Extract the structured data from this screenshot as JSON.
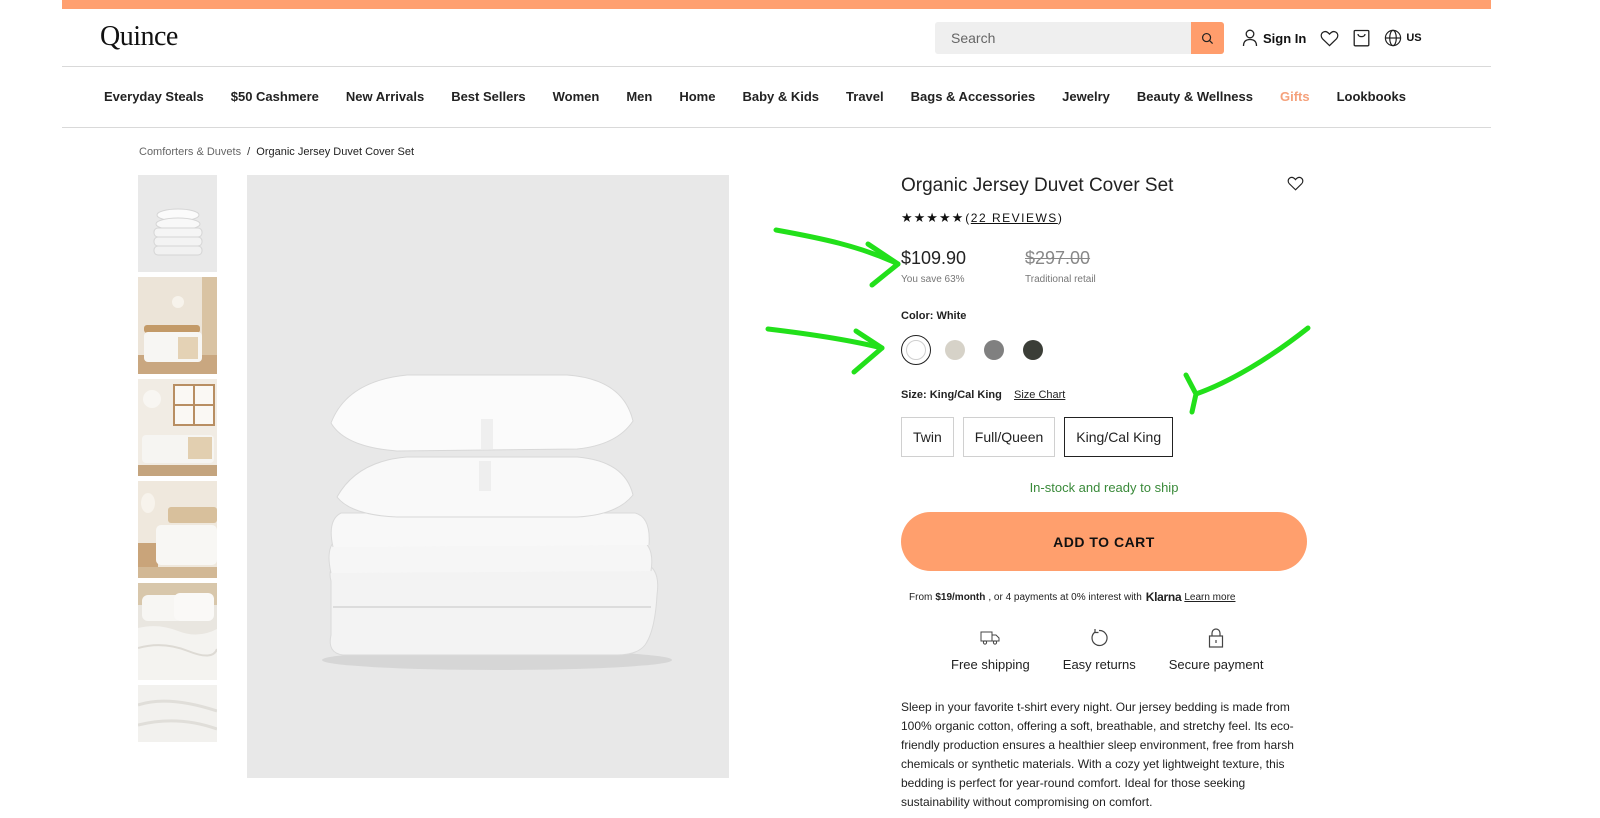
{
  "header": {
    "logo": "Quince",
    "search_placeholder": "Search",
    "sign_in": "Sign In",
    "locale": "US"
  },
  "nav": {
    "items": [
      {
        "label": "Everyday Steals"
      },
      {
        "label": "$50 Cashmere"
      },
      {
        "label": "New Arrivals"
      },
      {
        "label": "Best Sellers"
      },
      {
        "label": "Women"
      },
      {
        "label": "Men"
      },
      {
        "label": "Home"
      },
      {
        "label": "Baby & Kids"
      },
      {
        "label": "Travel"
      },
      {
        "label": "Bags & Accessories"
      },
      {
        "label": "Jewelry"
      },
      {
        "label": "Beauty & Wellness"
      },
      {
        "label": "Gifts"
      },
      {
        "label": "Lookbooks"
      }
    ]
  },
  "breadcrumb": {
    "parent": "Comforters & Duvets",
    "separator": "/",
    "current": "Organic Jersey Duvet Cover Set"
  },
  "product": {
    "title": "Organic Jersey Duvet Cover Set",
    "stars": "★★★★★",
    "rating_open": "(",
    "reviews_link": "22 REVIEWS",
    "rating_close": ")",
    "price": "$109.90",
    "savings": "You save 63%",
    "original_price": "$297.00",
    "original_label": "Traditional retail",
    "color_label": "Color: White",
    "swatches": [
      {
        "name": "White",
        "color": "#ffffff",
        "selected": true
      },
      {
        "name": "Sand",
        "color": "#d6d2c8",
        "selected": false
      },
      {
        "name": "Grey",
        "color": "#808080",
        "selected": false
      },
      {
        "name": "Charcoal",
        "color": "#3b3e37",
        "selected": false
      }
    ],
    "size_label": "Size: King/Cal King",
    "size_chart": "Size Chart",
    "sizes": [
      {
        "label": "Twin",
        "selected": false
      },
      {
        "label": "Full/Queen",
        "selected": false
      },
      {
        "label": "King/Cal King",
        "selected": true
      }
    ],
    "stock_status": "In-stock and ready to ship",
    "add_to_cart": "ADD TO CART",
    "klarna": {
      "prefix": "From",
      "amount": "$19/month",
      "middle": ", or 4 payments at 0% interest with",
      "brand": "Klarna",
      "learn_more": "Learn more"
    },
    "perks": [
      {
        "icon": "truck-icon",
        "label": "Free shipping"
      },
      {
        "icon": "returns-icon",
        "label": "Easy returns"
      },
      {
        "icon": "lock-icon",
        "label": "Secure payment"
      }
    ],
    "description": "Sleep in your favorite t-shirt every night. Our jersey bedding is made from 100% organic cotton, offering a soft, breathable, and stretchy feel. Its eco-friendly production ensures a healthier sleep environment, free from harsh chemicals or synthetic materials. With a cozy yet lightweight texture, this bedding is perfect for year-round comfort. Ideal for those seeking sustainability without compromising on comfort."
  },
  "gallery": {
    "thumbnails": [
      "stacked-bedding",
      "bedroom-wall-lamp",
      "bedroom-window",
      "bedroom-nightstand",
      "bedding-closeup",
      "fabric-detail"
    ]
  },
  "colors": {
    "promo_bar": "#ffa070",
    "accent": "#ff9f6d",
    "gifts_link": "#f5a17b",
    "stock_green": "#3a8a3a",
    "annotation_arrows": "#22e01a"
  }
}
